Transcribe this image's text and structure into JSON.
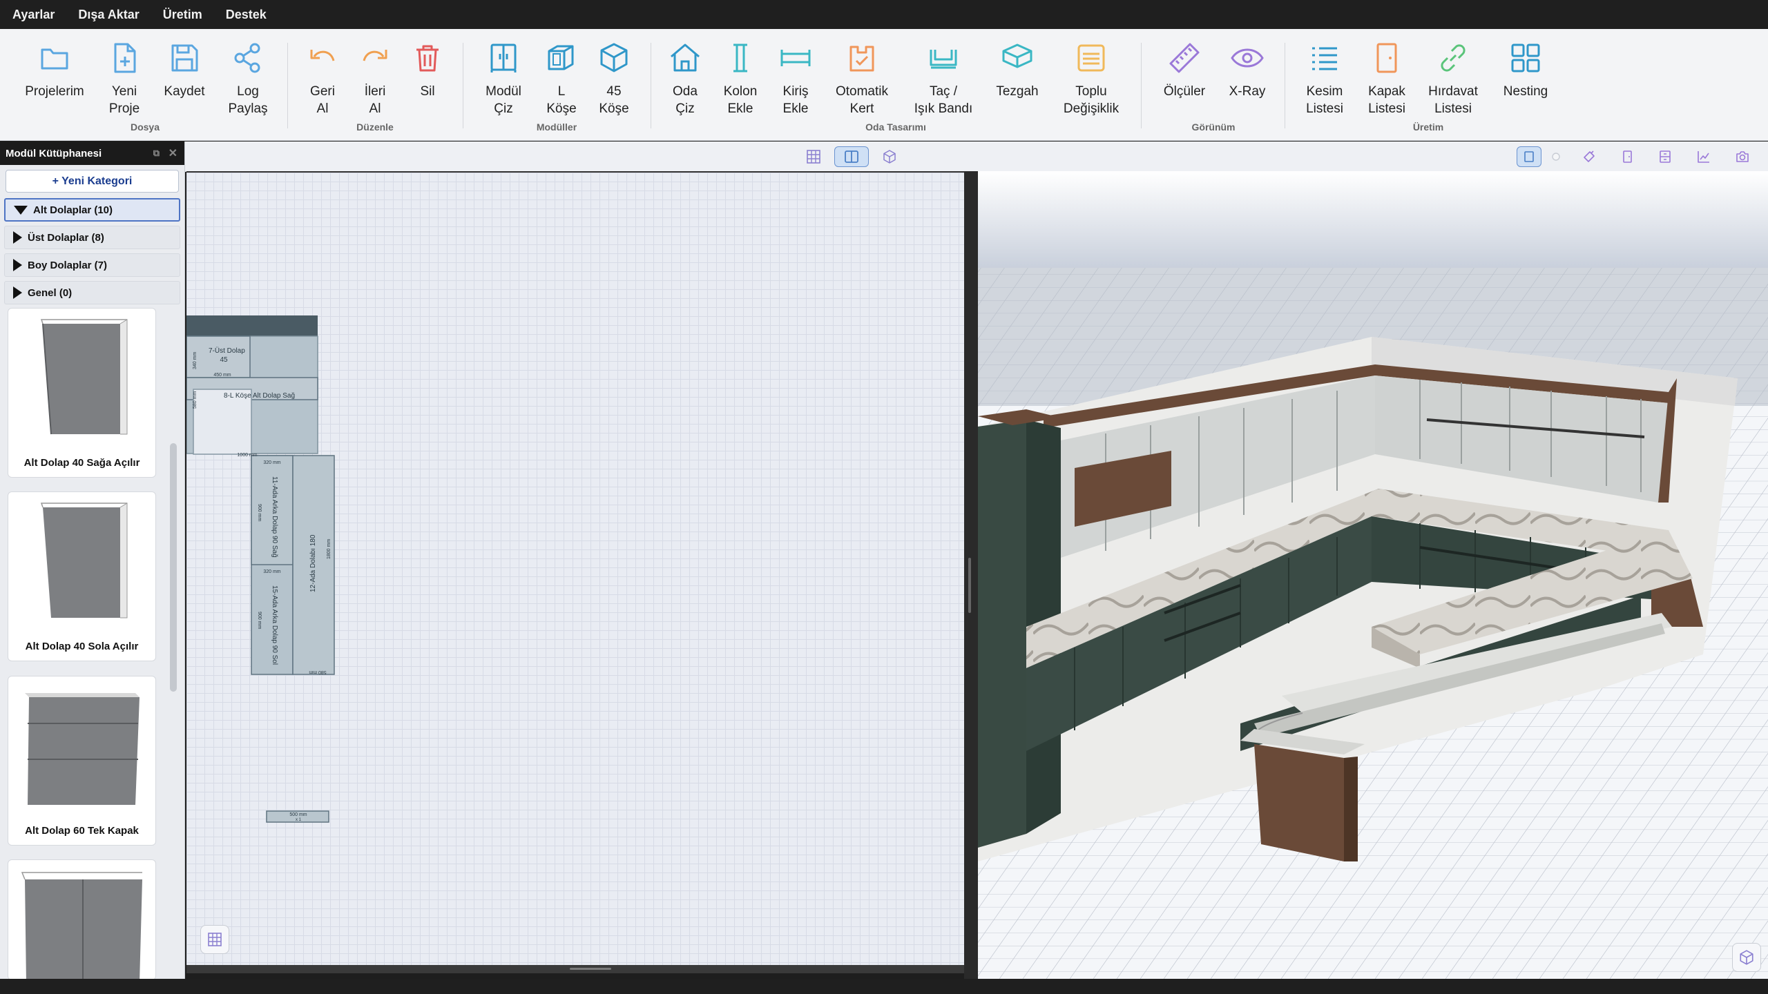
{
  "menu": {
    "items": [
      "Ayarlar",
      "Dışa Aktar",
      "Üretim",
      "Destek"
    ]
  },
  "ribbon": {
    "buttons": [
      {
        "label": "Projelerim",
        "icon": "folder-icon"
      },
      {
        "label": "Yeni\nProje",
        "icon": "new-file-icon"
      },
      {
        "label": "Kaydet",
        "icon": "save-icon"
      },
      {
        "label": "Log\nPaylaş",
        "icon": "share-icon"
      },
      {
        "label": "Geri\nAl",
        "icon": "undo-icon"
      },
      {
        "label": "İleri\nAl",
        "icon": "redo-icon"
      },
      {
        "label": "Sil",
        "icon": "trash-icon"
      },
      {
        "label": "Modül\nÇiz",
        "icon": "module-icon"
      },
      {
        "label": "L\nKöşe",
        "icon": "l-corner-icon"
      },
      {
        "label": "45\nKöşe",
        "icon": "45-corner-icon"
      },
      {
        "label": "Oda\nÇiz",
        "icon": "home-icon"
      },
      {
        "label": "Kolon\nEkle",
        "icon": "column-icon"
      },
      {
        "label": "Kiriş\nEkle",
        "icon": "beam-icon"
      },
      {
        "label": "Otomatik\nKert",
        "icon": "auto-notch-icon"
      },
      {
        "label": "Taç /\nIşık Bandı",
        "icon": "crown-light-icon"
      },
      {
        "label": "Tezgah",
        "icon": "countertop-icon"
      },
      {
        "label": "Toplu\nDeğişiklik",
        "icon": "bulk-edit-icon"
      },
      {
        "label": "Ölçüler",
        "icon": "ruler-icon"
      },
      {
        "label": "X-Ray",
        "icon": "eye-icon"
      },
      {
        "label": "Kesim\nListesi",
        "icon": "list-icon"
      },
      {
        "label": "Kapak\nListesi",
        "icon": "door-icon"
      },
      {
        "label": "Hırdavat\nListesi",
        "icon": "link-icon"
      },
      {
        "label": "Nesting",
        "icon": "grid-icon"
      }
    ],
    "groups": [
      "Dosya",
      "Düzenle",
      "Modüller",
      "Oda Tasarımı",
      "Görünüm",
      "Üretim"
    ]
  },
  "sidebar": {
    "title": "Modül Kütüphanesi",
    "new_category": "+ Yeni Kategori",
    "categories": [
      {
        "label": "Alt Dolaplar  (10)"
      },
      {
        "label": "Üst Dolaplar  (8)"
      },
      {
        "label": "Boy Dolaplar  (7)"
      },
      {
        "label": "Genel  (0)"
      }
    ],
    "modules": [
      {
        "label": "Alt Dolap 40 Sağa Açılır"
      },
      {
        "label": "Alt Dolap 40 Sola Açılır"
      },
      {
        "label": "Alt Dolap 60 Tek Kapak"
      }
    ]
  },
  "plan": {
    "labels": {
      "ust_dolap": "7-Üst Dolap",
      "ust_dolap_n": "45",
      "dim_450": "450 mm",
      "dim_340": "340 mm",
      "dim_580": "580 mm",
      "l_kose": "8-L Köşe Alt Dolap Sağ",
      "dim_1000": "1000 mm",
      "dim_320a": "320 mm",
      "dim_320b": "320 mm",
      "ada11": "11-Ada Arka Dolap 90 Sağ",
      "ada15": "15-Ada Arka Dolap 90 Sol",
      "ada12": "12-Ada Dolabı 180",
      "dim_900a": "900 mm",
      "dim_900b": "900 mm",
      "dim_1800": "1800 mm",
      "dim_580b": "580 mm",
      "dim_500": "500 mm",
      "dim_x1": "x 1"
    }
  }
}
